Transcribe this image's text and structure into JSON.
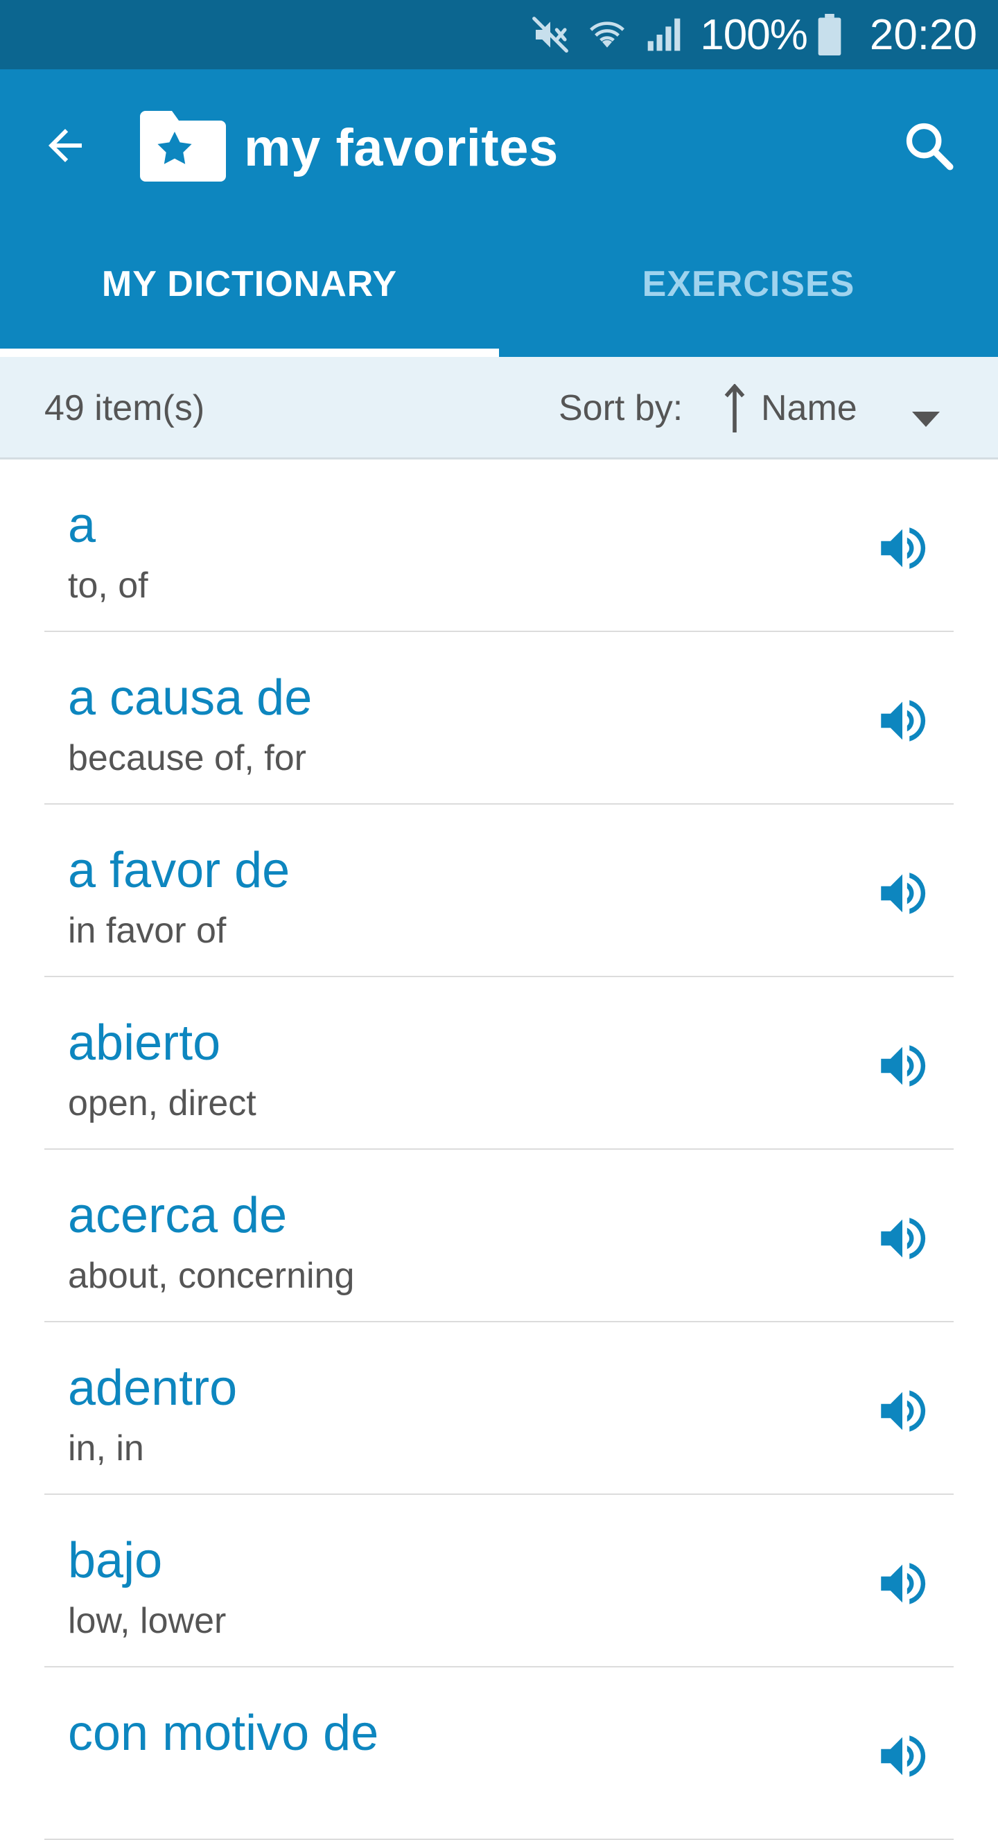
{
  "status_bar": {
    "battery": "100%",
    "time": "20:20",
    "icons": [
      "mute-icon",
      "wifi-icon",
      "signal-icon",
      "battery-icon"
    ]
  },
  "app_bar": {
    "title": "my favorites",
    "back_icon": "arrow-left-icon",
    "logo_icon": "star-folder-icon",
    "search_icon": "search-icon",
    "color": "#0d86bf"
  },
  "tabs": [
    {
      "label": "MY DICTIONARY",
      "active": true
    },
    {
      "label": "EXERCISES",
      "active": false
    }
  ],
  "sort_bar": {
    "count": "49 item(s)",
    "sort_label": "Sort by:",
    "sort_value": "Name",
    "sort_direction_icon": "arrow-up-icon",
    "dropdown_icon": "triangle-down-icon"
  },
  "items": [
    {
      "word": "a",
      "translation": "to, of"
    },
    {
      "word": "a causa de",
      "translation": "because of, for"
    },
    {
      "word": "a favor de",
      "translation": "in favor of"
    },
    {
      "word": "abierto",
      "translation": "open, direct"
    },
    {
      "word": "acerca de",
      "translation": "about, concerning"
    },
    {
      "word": "adentro",
      "translation": "in, in"
    },
    {
      "word": "bajo",
      "translation": "low, lower"
    },
    {
      "word": "con motivo de",
      "translation": ""
    }
  ]
}
